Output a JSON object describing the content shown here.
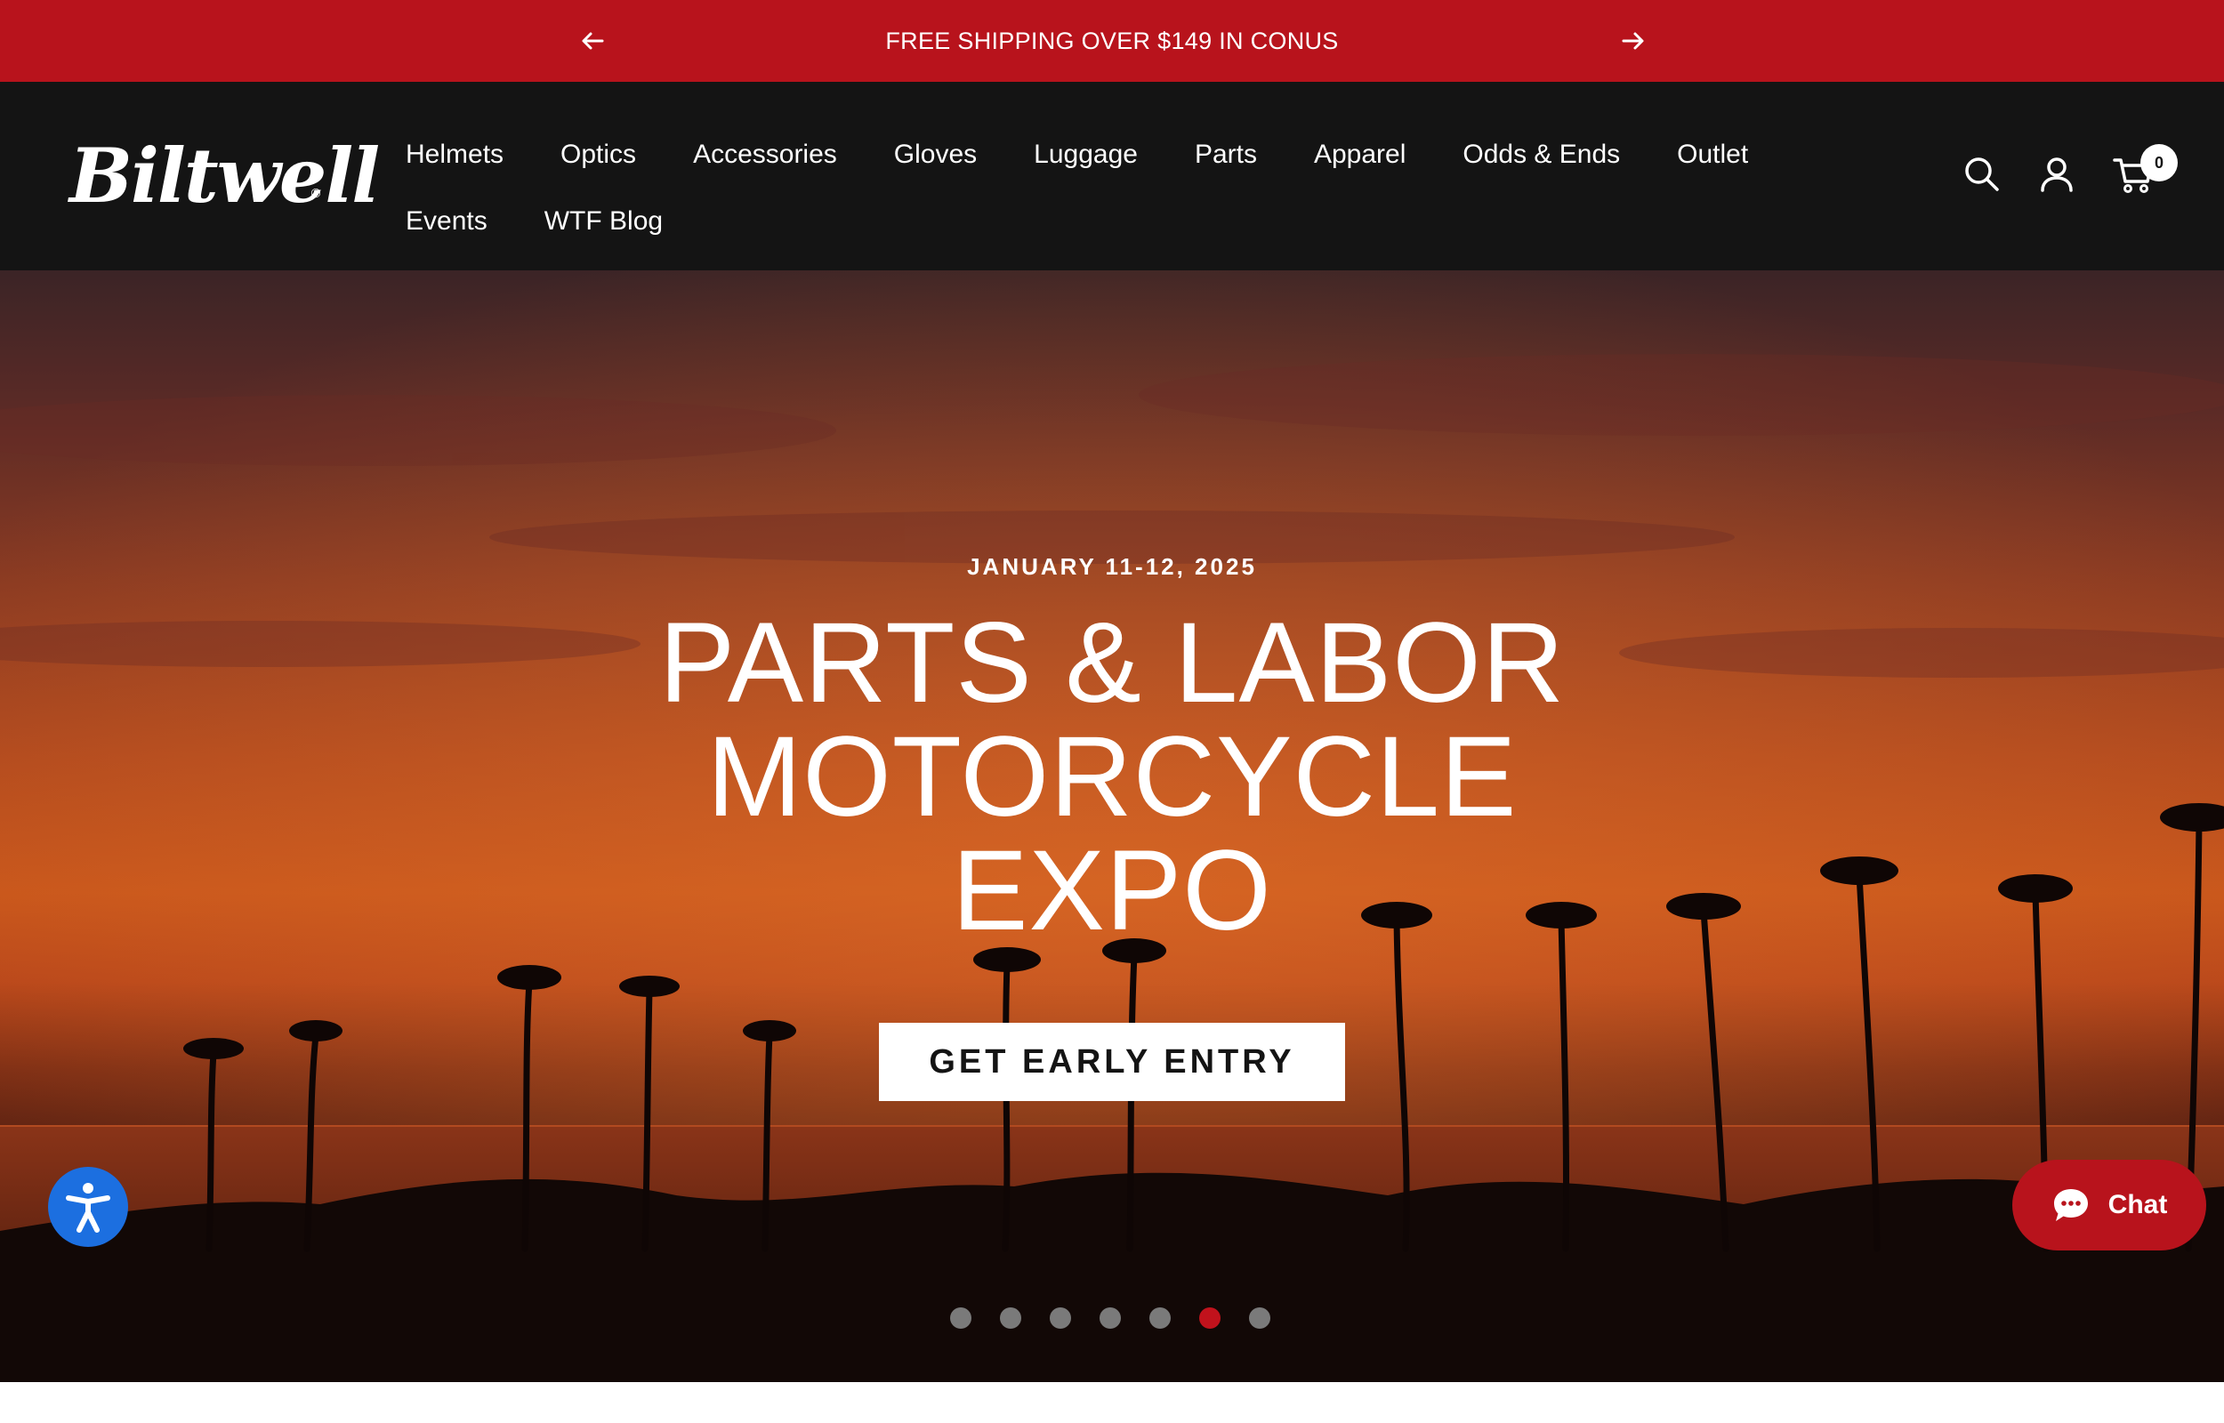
{
  "announcement": {
    "text": "FREE SHIPPING OVER $149 IN CONUS",
    "prev_icon": "arrow-left-icon",
    "next_icon": "arrow-right-icon"
  },
  "header": {
    "logo_text": "Biltwell",
    "logo_mark": "®",
    "nav": {
      "row1": [
        "Helmets",
        "Optics",
        "Accessories",
        "Gloves",
        "Luggage",
        "Parts",
        "Apparel",
        "Odds & Ends",
        "Outlet"
      ],
      "row2": [
        "Events",
        "WTF Blog"
      ]
    },
    "icons": [
      "search-icon",
      "account-icon",
      "cart-icon"
    ],
    "cart_count": "0"
  },
  "hero": {
    "eyebrow": "JANUARY 11-12, 2025",
    "title_lines": [
      "PARTS & LABOR",
      "MOTORCYCLE",
      "EXPO"
    ],
    "cta_label": "GET EARLY ENTRY",
    "slide_count": 7,
    "active_slide": 6
  },
  "widgets": {
    "accessibility_icon": "accessibility-icon",
    "chat_label": "Chat",
    "chat_icon": "chat-bubble-icon"
  },
  "colors": {
    "brand_red": "#b8131c",
    "header_bg": "#141414",
    "accessibility_blue": "#1c6fe0",
    "dot_inactive": "#7a7a7a",
    "dot_active": "#c1121c"
  }
}
